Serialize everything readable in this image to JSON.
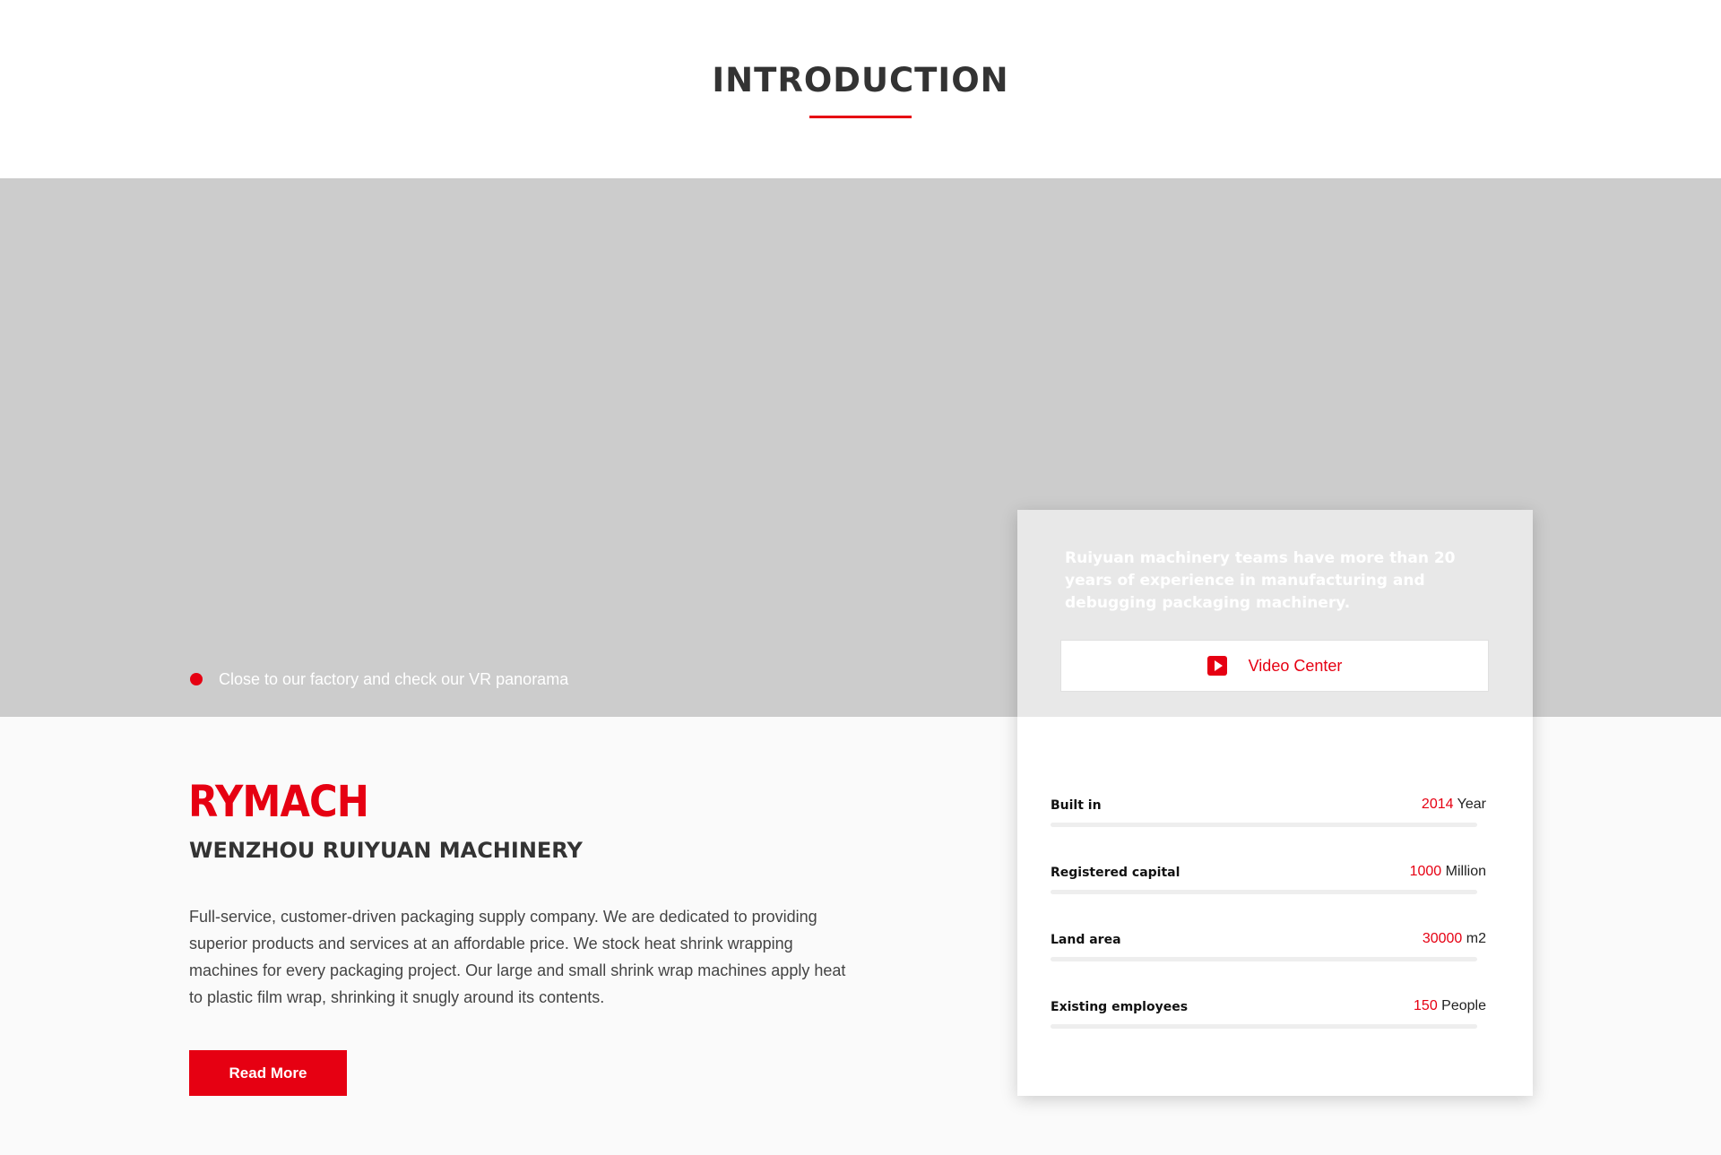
{
  "section": {
    "title": "INTRODUCTION"
  },
  "hero": {
    "vr_text": "Close to our factory and check our VR panorama"
  },
  "company": {
    "logo_text": "RYMACH",
    "name": "WENZHOU RUIYUAN MACHINERY",
    "description": "Full-service, customer-driven packaging supply company. We are dedicated to providing superior products and services at an affordable price. We stock heat shrink wrapping machines for every packaging project. Our large and small shrink wrap machines apply heat to plastic film wrap, shrinking it snugly around its contents.",
    "read_more_label": "Read More"
  },
  "card": {
    "tagline": "Ruiyuan machinery teams have more than 20 years of experience in manufacturing and debugging packaging machinery.",
    "video_label": "Video Center",
    "video_icon": "play-icon",
    "stats": [
      {
        "label": "Built in",
        "value": "2014",
        "unit": "Year"
      },
      {
        "label": "Registered capital",
        "value": "1000",
        "unit": "Million"
      },
      {
        "label": "Land area",
        "value": "30000",
        "unit": "m2"
      },
      {
        "label": "Existing employees",
        "value": "150",
        "unit": "People"
      }
    ]
  },
  "colors": {
    "accent": "#e60012",
    "hero_bg": "#cccccc",
    "text": "#333333"
  }
}
